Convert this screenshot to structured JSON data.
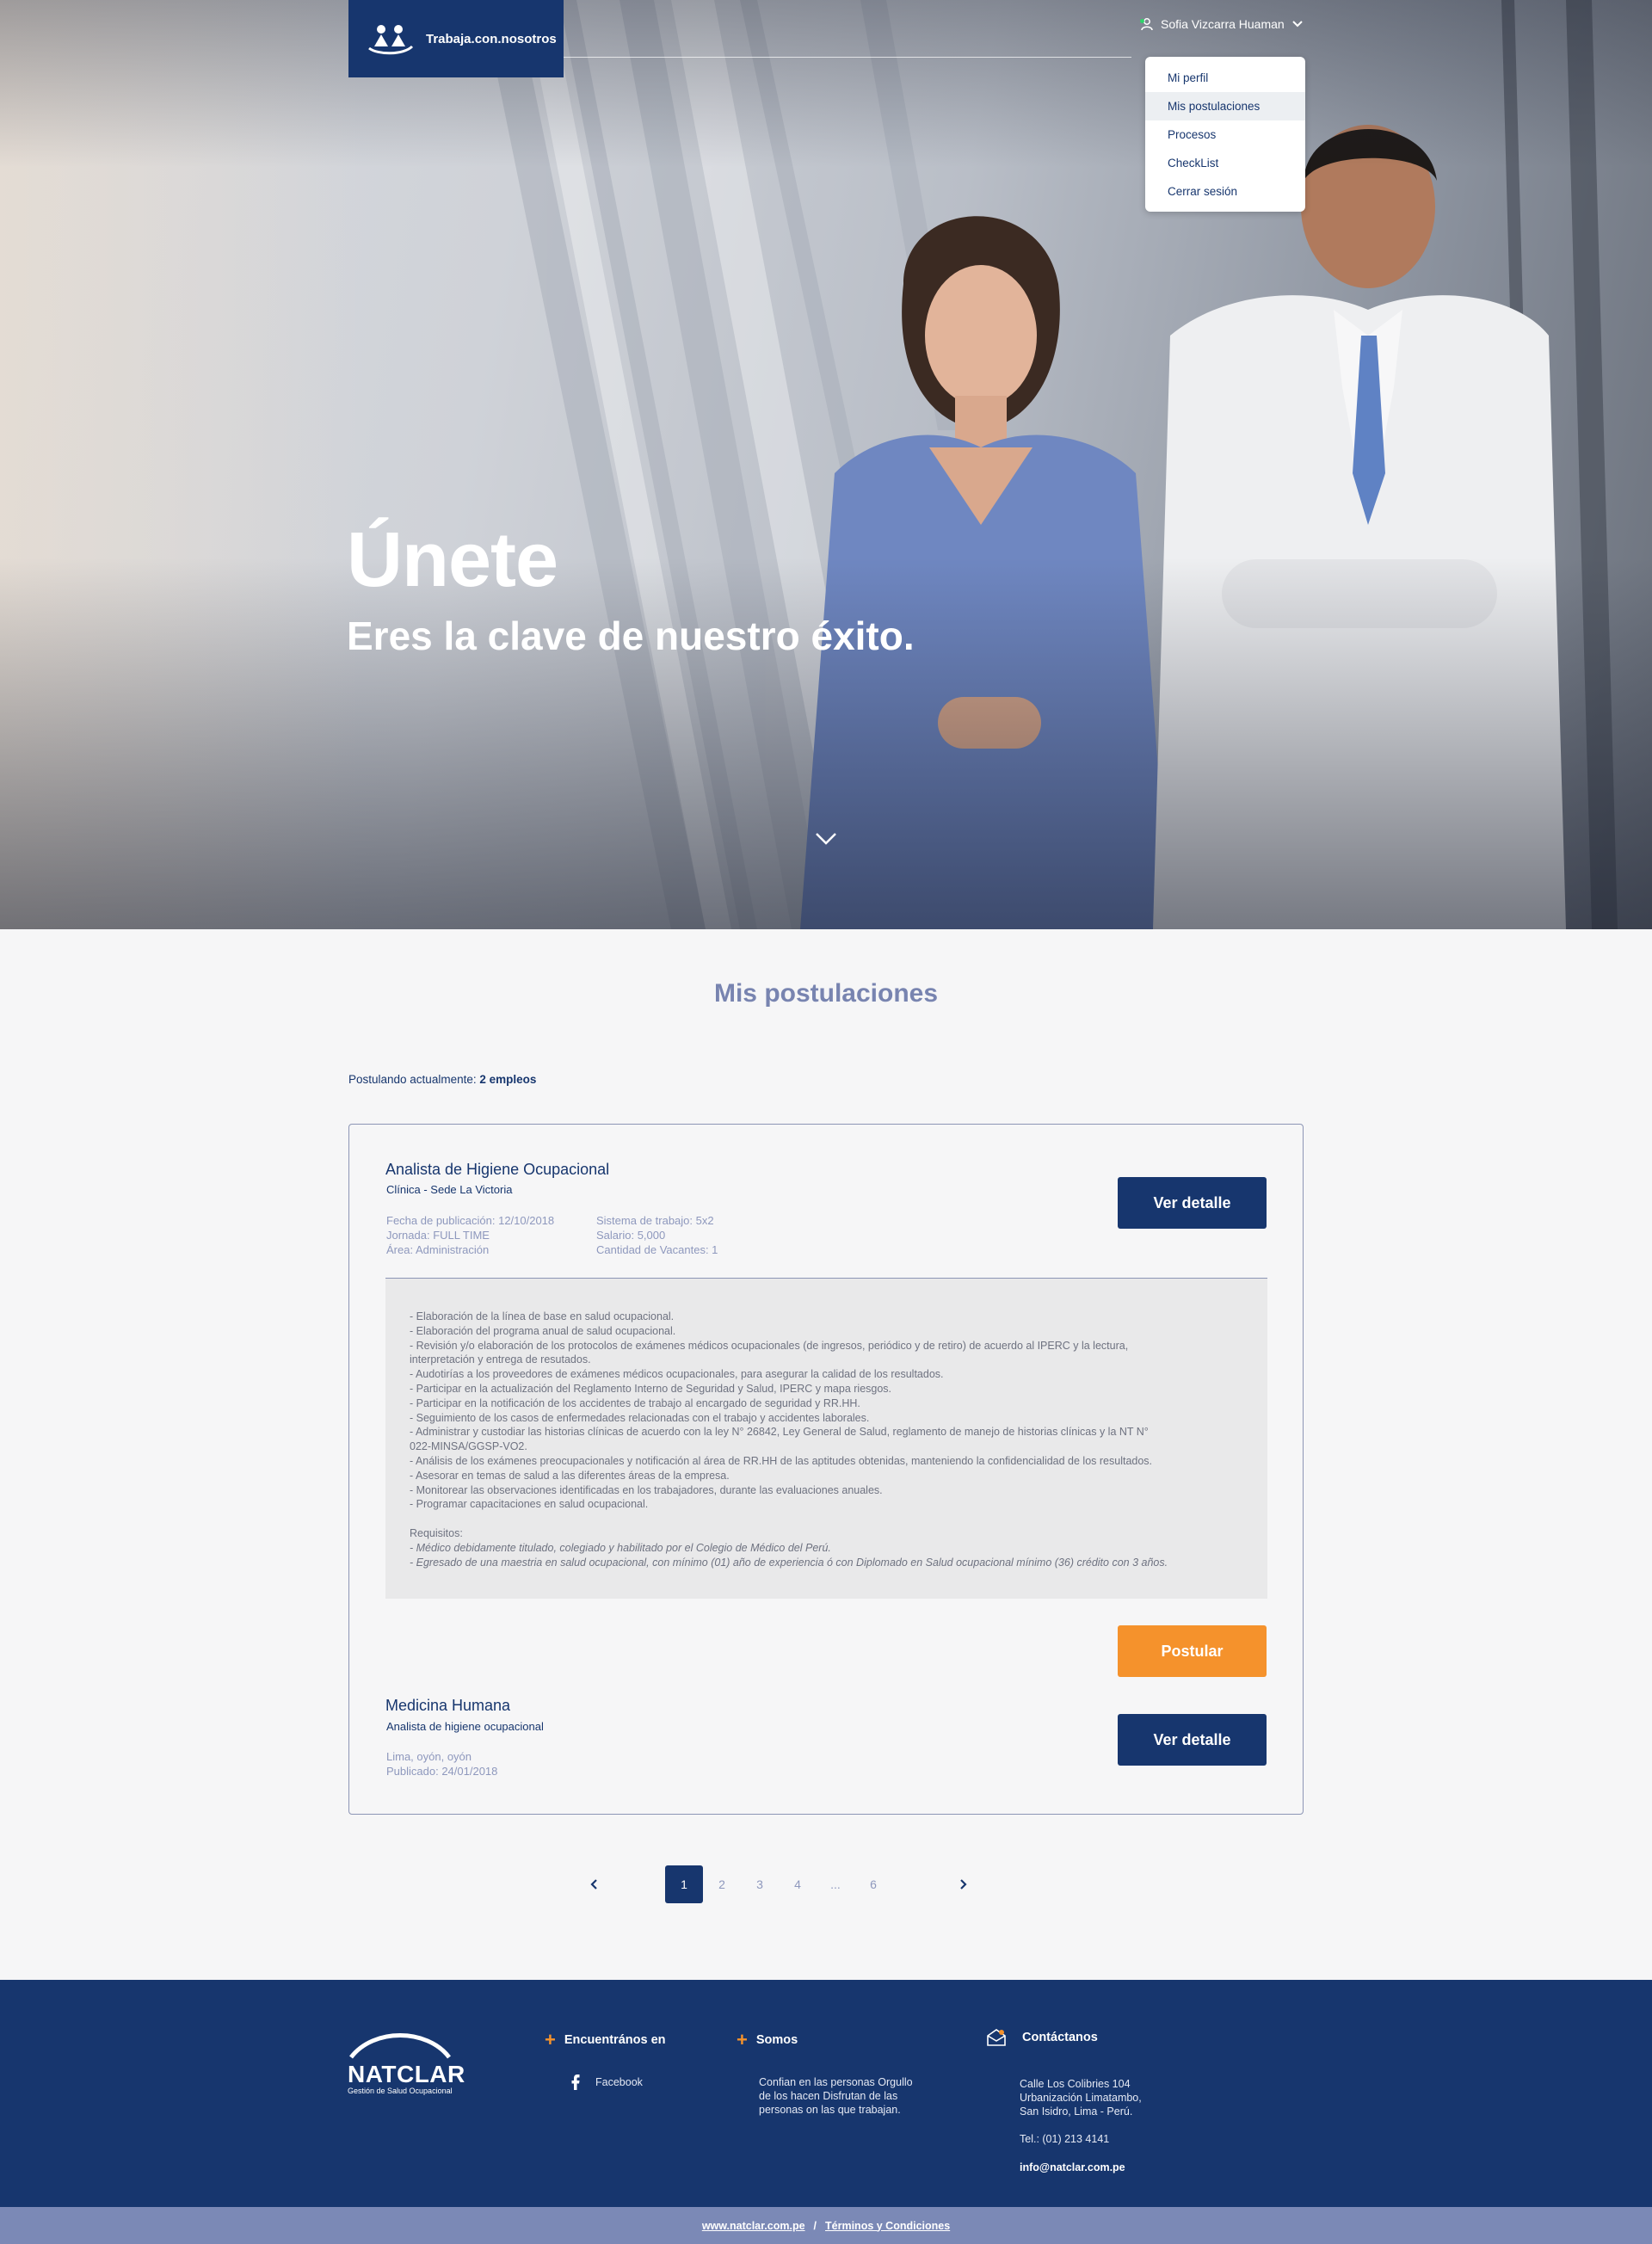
{
  "header": {
    "logo_text": "Trabaja.con.nosotros",
    "user_name": "Sofia Vizcarra Huaman",
    "menu": [
      {
        "label": "Mi perfil"
      },
      {
        "label": "Mis postulaciones"
      },
      {
        "label": "Procesos"
      },
      {
        "label": "CheckList"
      },
      {
        "label": "Cerrar sesión"
      }
    ],
    "active_menu_index": 1
  },
  "hero": {
    "title": "Únete",
    "subtitle": "Eres la clave de nuestro éxito."
  },
  "main": {
    "section_title": "Mis postulaciones",
    "count_label": "Postulando actualmente:",
    "count_value": "2 empleos",
    "jobs": [
      {
        "title": "Analista de Higiene Ocupacional",
        "subtitle": "Clínica - Sede La Victoria",
        "meta_left": [
          "Fecha de publicación: 12/10/2018",
          "Jornada: FULL TIME",
          "Área: Administración"
        ],
        "meta_right": [
          "Sistema de trabajo: 5x2",
          "Salario: 5,000",
          "Cantidad de Vacantes: 1"
        ],
        "detail_button": "Ver detalle",
        "description": [
          "- Elaboración de la línea de base en salud ocupacional.",
          "- Elaboración del programa anual de salud ocupacional.",
          "- Revisión y/o elaboración de los protocolos de exámenes médicos ocupacionales (de ingresos, periódico y de retiro) de acuerdo al IPERC y la lectura,",
          "interpretación y entrega de resutados.",
          "- Audotirías a los proveedores de exámenes médicos ocupacionales, para asegurar la calidad de los resultados.",
          "- Participar en la actualización del Reglamento Interno de Seguridad y Salud, IPERC y mapa riesgos.",
          "- Participar en la notificación de los accidentes de trabajo al encargado de seguridad y RR.HH.",
          "- Seguimiento de los casos de enfermedades relacionadas con el trabajo y accidentes laborales.",
          "- Administrar y custodiar las historias clínicas de acuerdo con la ley N° 26842, Ley General de Salud, reglamento de manejo de historias clínicas y la NT N°",
          "022-MINSA/GGSP-VO2.",
          "- Análisis de los exámenes preocupacionales y notificación al área de RR.HH de las aptitudes obtenidas, manteniendo la confidencialidad de los resultados.",
          "- Asesorar en temas de salud a las diferentes áreas de la empresa.",
          "- Monitorear las observaciones identificadas en los trabajadores, durante las evaluaciones anuales.",
          "- Programar capacitaciones en salud ocupacional."
        ],
        "requirements_label": "Requisitos:",
        "requirements": [
          "- Médico debidamente titulado, colegiado y habilitado por el Colegio de Médico del Perú.",
          "- Egresado de una maestria en salud ocupacional, con mínimo (01) año de experiencia ó con Diplomado en Salud ocupacional mínimo (36) crédito con 3 años."
        ],
        "apply_button": "Postular"
      },
      {
        "title": "Medicina Humana",
        "subtitle": "Analista de higiene ocupacional",
        "meta_left": [
          "Lima, oyón, oyón",
          "Publicado: 24/01/2018"
        ],
        "detail_button": "Ver detalle"
      }
    ]
  },
  "pagination": {
    "pages": [
      "1",
      "2",
      "3",
      "4",
      "...",
      "6"
    ],
    "current": "1"
  },
  "footer": {
    "brand": "NATCLAR",
    "brand_tagline": "Gestión de Salud Ocupacional",
    "find_us_title": "Encuentrános en",
    "facebook_label": "Facebook",
    "about_title": "Somos",
    "about_text": [
      "Confian en las personas Orgullo",
      "de los hacen Disfrutan de las",
      "personas on las que trabajan."
    ],
    "contact_title": "Contáctanos",
    "address": [
      "Calle Los Colibries 104",
      "Urbanización Limatambo,",
      "San Isidro, Lima - Perú."
    ],
    "phone": "Tel.: (01) 213 4141",
    "email": "info@natclar.com.pe",
    "bottom_link_1": "www.natclar.com.pe",
    "separator": "/",
    "bottom_link_2": "Términos y Condiciones"
  },
  "colors": {
    "primary": "#17366e",
    "accent": "#f5922c",
    "muted": "#8e98bd",
    "bottom_bar": "#7b89b6"
  }
}
